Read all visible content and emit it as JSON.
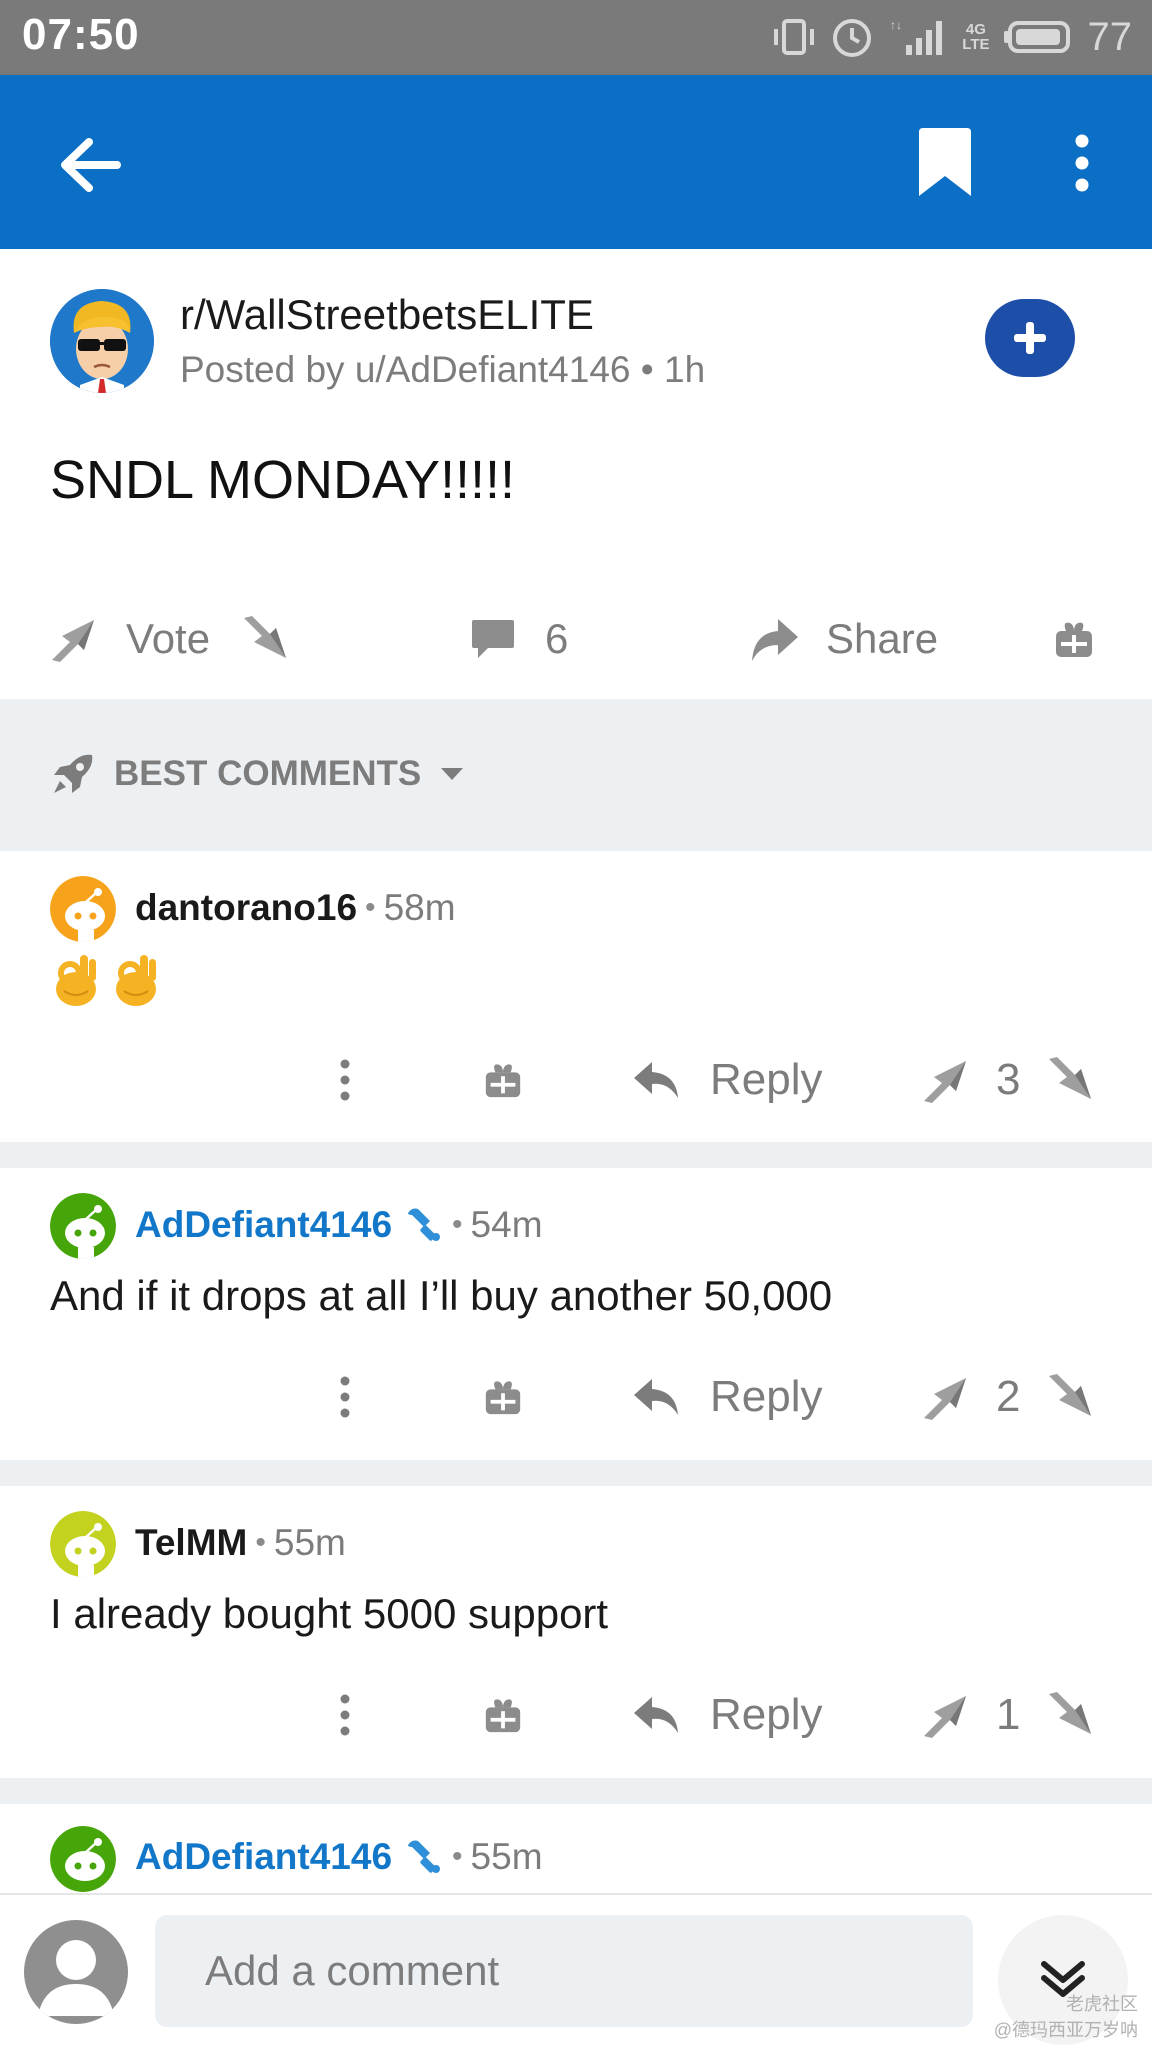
{
  "status_bar": {
    "time": "07:50",
    "network": "4G",
    "network_sub": "LTE",
    "battery": "77",
    "icons": [
      "vibrate-icon",
      "alarm-icon",
      "signal-icon",
      "battery-icon"
    ]
  },
  "app_bar": {
    "color": "#0c6fc6",
    "icons": [
      "back-arrow-icon",
      "bookmark-icon",
      "more-vertical-icon"
    ]
  },
  "post": {
    "subreddit": "r/WallStreetbetsELITE",
    "meta": "Posted by u/AdDefiant4146 • 1h",
    "title": "SNDL MONDAY!!!!!",
    "vote_label": "Vote",
    "comment_count": "6",
    "share_label": "Share"
  },
  "sort": {
    "label": "BEST COMMENTS"
  },
  "comments": [
    {
      "user": "dantorano16",
      "time": "58m",
      "body": "",
      "emojis": [
        "ok-hand-emoji",
        "ok-hand-emoji"
      ],
      "score": "3",
      "reply_label": "Reply",
      "avatar_color": "#f7a21b"
    },
    {
      "user": "AdDefiant4146",
      "time": "54m",
      "body": "And if it drops at all I’ll buy another 50,000",
      "score": "2",
      "reply_label": "Reply",
      "avatar_color": "#46a508",
      "op": true
    },
    {
      "user": "TelMM",
      "time": "55m",
      "body": "I already bought 5000 support",
      "score": "1",
      "reply_label": "Reply",
      "avatar_color": "#c3d11f"
    },
    {
      "user": "AdDefiant4146",
      "time": "55m",
      "avatar_color": "#46a508",
      "op": true
    }
  ],
  "composer": {
    "placeholder": "Add a comment"
  },
  "watermark": {
    "line1": "老虎社区",
    "line2": "@德玛西亚万岁呐"
  }
}
